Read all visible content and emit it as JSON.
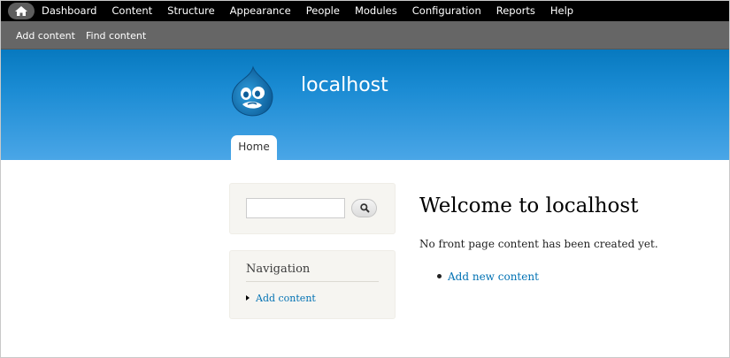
{
  "toolbar": {
    "items": [
      "Dashboard",
      "Content",
      "Structure",
      "Appearance",
      "People",
      "Modules",
      "Configuration",
      "Reports",
      "Help"
    ]
  },
  "shortcuts": {
    "add_content": "Add content",
    "find_content": "Find content"
  },
  "header": {
    "site_name": "localhost",
    "tab_home": "Home"
  },
  "sidebar": {
    "search_value": "",
    "navigation_title": "Navigation",
    "navigation_link": "Add content"
  },
  "main": {
    "title": "Welcome to localhost",
    "message": "No front page content has been created yet.",
    "link": "Add new content"
  },
  "colors": {
    "admin_bar": "#000000",
    "shortcut_bar": "#666666",
    "header_top": "#0779bf",
    "header_bottom": "#4aa6e7",
    "link": "#0071b3"
  }
}
